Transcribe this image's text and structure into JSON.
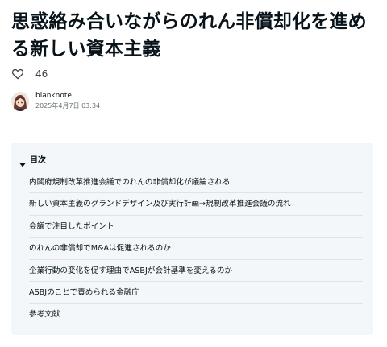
{
  "article": {
    "title": "思惑絡み合いながらのれん非償却化を進める新しい資本主義"
  },
  "likes": {
    "icon": "heart-outline-icon",
    "count": "46"
  },
  "author": {
    "avatar_icon": "avatar",
    "name": "blanknote",
    "date": "2025年4月7日 03:34"
  },
  "toc": {
    "heading": "目次",
    "caret_icon": "caret-down-icon",
    "items": [
      "内閣府規制改革推進会議でのれんの非償却化が議論される",
      "新しい資本主義のグランドデザイン及び実行計画→規制改革推進会議の流れ",
      "会議で注目したポイント",
      "のれんの非償却でM&Aは促進されるのか",
      "企業行動の変化を促す理由でASBJが会計基準を変えるのか",
      "ASBJのことで責められる金融庁",
      "参考文献"
    ]
  },
  "colors": {
    "text": "#08131a",
    "muted": "#6b7378",
    "toc_background": "#f3f7f9",
    "divider": "#dde3e6"
  }
}
